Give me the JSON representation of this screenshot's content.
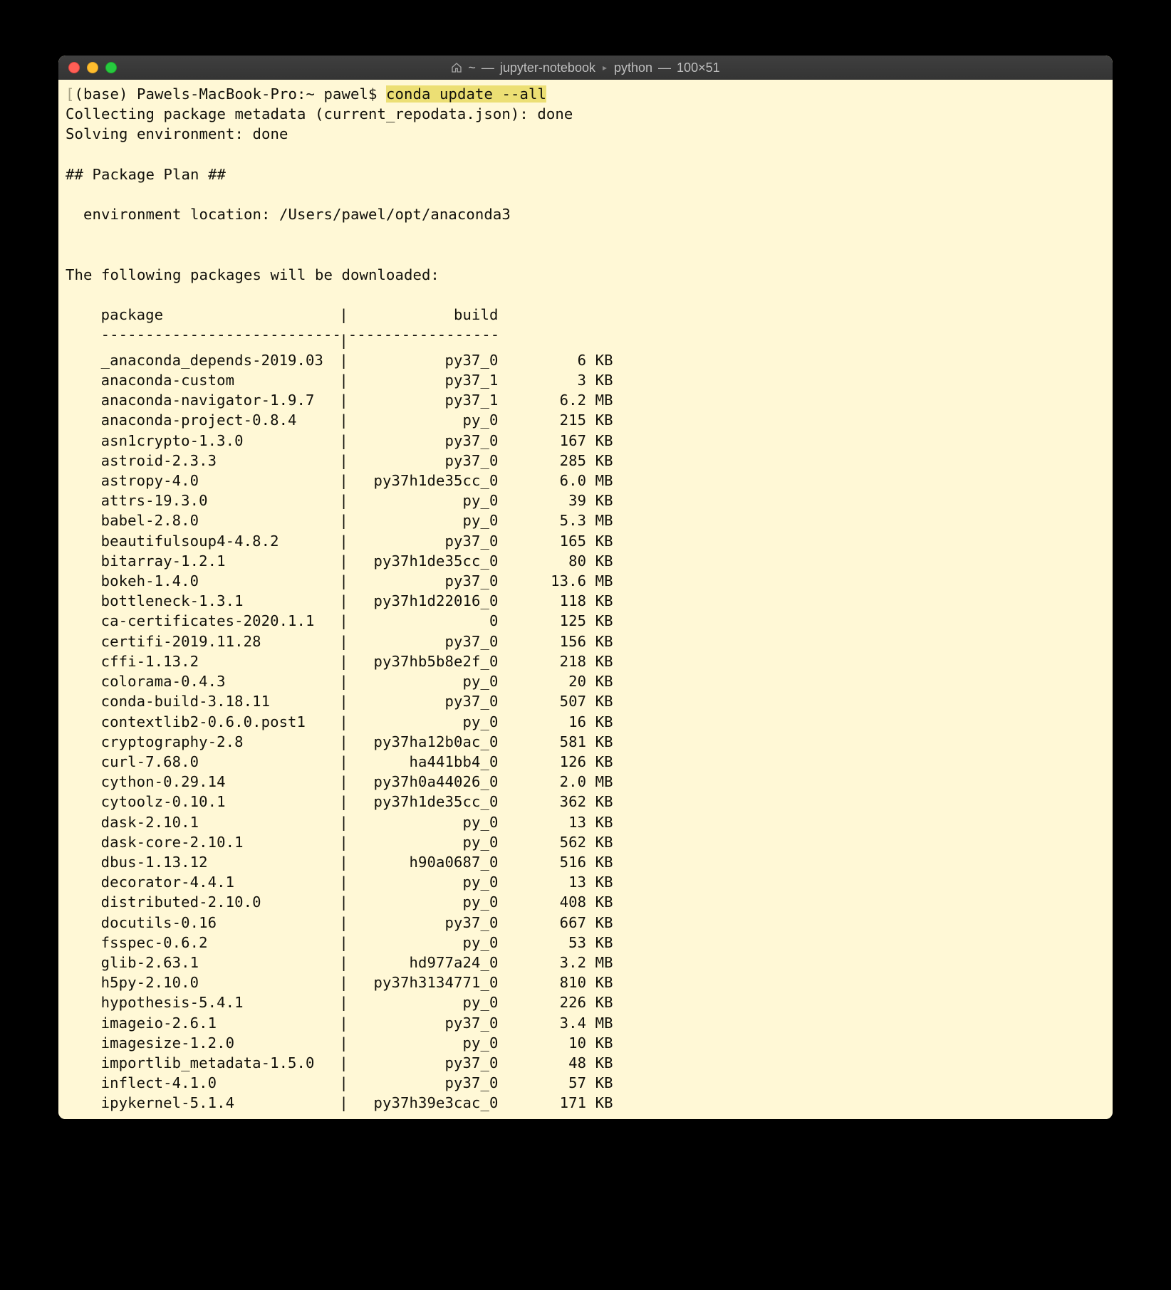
{
  "title": {
    "icon": "home-icon",
    "path": "~",
    "dash": "—",
    "process": "jupyter-notebook",
    "subprocess": "python",
    "dimensions": "100×51"
  },
  "prompt": {
    "open_bracket": "[",
    "env": "(base) ",
    "host": "Pawels-MacBook-Pro:~ pawel$ ",
    "command": "conda update --all",
    "close_bracket": "]"
  },
  "pre_lines": [
    "Collecting package metadata (current_repodata.json): done",
    "Solving environment: done",
    "",
    "## Package Plan ##",
    "",
    "  environment location: /Users/pawel/opt/anaconda3",
    "",
    "",
    "The following packages will be downloaded:",
    ""
  ],
  "table_header": {
    "package": "package",
    "build": "build"
  },
  "dashes": {
    "left": "---------------------------",
    "right": "-----------------"
  },
  "packages": [
    {
      "name": "_anaconda_depends-2019.03",
      "build": "py37_0",
      "size": "6 KB"
    },
    {
      "name": "anaconda-custom",
      "build": "py37_1",
      "size": "3 KB"
    },
    {
      "name": "anaconda-navigator-1.9.7",
      "build": "py37_1",
      "size": "6.2 MB"
    },
    {
      "name": "anaconda-project-0.8.4",
      "build": "py_0",
      "size": "215 KB"
    },
    {
      "name": "asn1crypto-1.3.0",
      "build": "py37_0",
      "size": "167 KB"
    },
    {
      "name": "astroid-2.3.3",
      "build": "py37_0",
      "size": "285 KB"
    },
    {
      "name": "astropy-4.0",
      "build": "py37h1de35cc_0",
      "size": "6.0 MB"
    },
    {
      "name": "attrs-19.3.0",
      "build": "py_0",
      "size": "39 KB"
    },
    {
      "name": "babel-2.8.0",
      "build": "py_0",
      "size": "5.3 MB"
    },
    {
      "name": "beautifulsoup4-4.8.2",
      "build": "py37_0",
      "size": "165 KB"
    },
    {
      "name": "bitarray-1.2.1",
      "build": "py37h1de35cc_0",
      "size": "80 KB"
    },
    {
      "name": "bokeh-1.4.0",
      "build": "py37_0",
      "size": "13.6 MB"
    },
    {
      "name": "bottleneck-1.3.1",
      "build": "py37h1d22016_0",
      "size": "118 KB"
    },
    {
      "name": "ca-certificates-2020.1.1",
      "build": "0",
      "size": "125 KB"
    },
    {
      "name": "certifi-2019.11.28",
      "build": "py37_0",
      "size": "156 KB"
    },
    {
      "name": "cffi-1.13.2",
      "build": "py37hb5b8e2f_0",
      "size": "218 KB"
    },
    {
      "name": "colorama-0.4.3",
      "build": "py_0",
      "size": "20 KB"
    },
    {
      "name": "conda-build-3.18.11",
      "build": "py37_0",
      "size": "507 KB"
    },
    {
      "name": "contextlib2-0.6.0.post1",
      "build": "py_0",
      "size": "16 KB"
    },
    {
      "name": "cryptography-2.8",
      "build": "py37ha12b0ac_0",
      "size": "581 KB"
    },
    {
      "name": "curl-7.68.0",
      "build": "ha441bb4_0",
      "size": "126 KB"
    },
    {
      "name": "cython-0.29.14",
      "build": "py37h0a44026_0",
      "size": "2.0 MB"
    },
    {
      "name": "cytoolz-0.10.1",
      "build": "py37h1de35cc_0",
      "size": "362 KB"
    },
    {
      "name": "dask-2.10.1",
      "build": "py_0",
      "size": "13 KB"
    },
    {
      "name": "dask-core-2.10.1",
      "build": "py_0",
      "size": "562 KB"
    },
    {
      "name": "dbus-1.13.12",
      "build": "h90a0687_0",
      "size": "516 KB"
    },
    {
      "name": "decorator-4.4.1",
      "build": "py_0",
      "size": "13 KB"
    },
    {
      "name": "distributed-2.10.0",
      "build": "py_0",
      "size": "408 KB"
    },
    {
      "name": "docutils-0.16",
      "build": "py37_0",
      "size": "667 KB"
    },
    {
      "name": "fsspec-0.6.2",
      "build": "py_0",
      "size": "53 KB"
    },
    {
      "name": "glib-2.63.1",
      "build": "hd977a24_0",
      "size": "3.2 MB"
    },
    {
      "name": "h5py-2.10.0",
      "build": "py37h3134771_0",
      "size": "810 KB"
    },
    {
      "name": "hypothesis-5.4.1",
      "build": "py_0",
      "size": "226 KB"
    },
    {
      "name": "imageio-2.6.1",
      "build": "py37_0",
      "size": "3.4 MB"
    },
    {
      "name": "imagesize-1.2.0",
      "build": "py_0",
      "size": "10 KB"
    },
    {
      "name": "importlib_metadata-1.5.0",
      "build": "py37_0",
      "size": "48 KB"
    },
    {
      "name": "inflect-4.1.0",
      "build": "py37_0",
      "size": "57 KB"
    },
    {
      "name": "ipykernel-5.1.4",
      "build": "py37h39e3cac_0",
      "size": "171 KB"
    }
  ]
}
